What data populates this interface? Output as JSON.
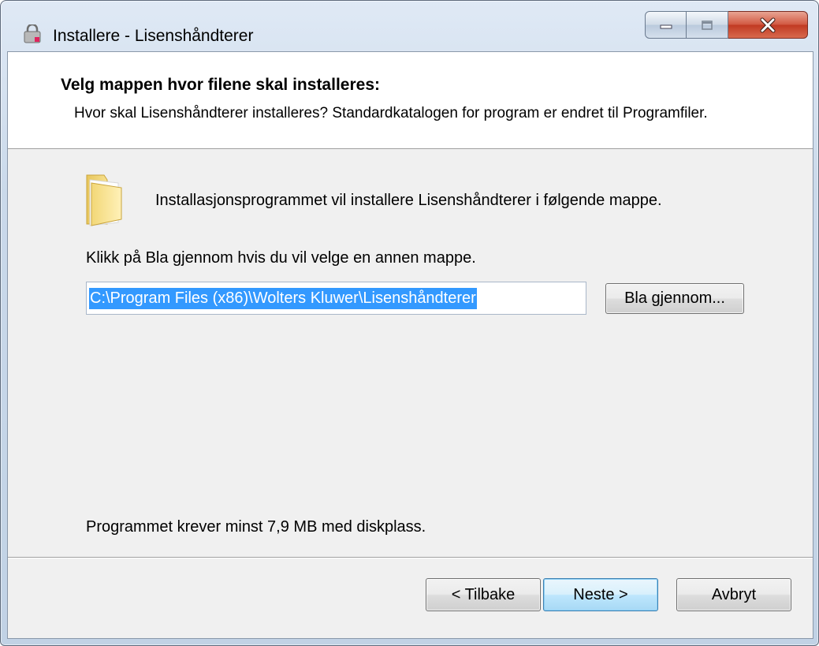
{
  "window": {
    "title": "Installere - Lisenshåndterer",
    "controls": {
      "minimize": "minimize",
      "maximize": "maximize",
      "close": "close"
    }
  },
  "header": {
    "title": "Velg mappen hvor filene skal installeres:",
    "subtitle": "Hvor skal Lisenshåndterer installeres? Standardkatalogen for program er endret til Programfiler."
  },
  "body": {
    "intro": "Installasjonsprogrammet vil installere Lisenshåndterer i følgende mappe.",
    "instruction": "Klikk på Bla gjennom hvis du vil velge en annen mappe.",
    "path_value": "C:\\Program Files (x86)\\Wolters Kluwer\\Lisenshåndterer",
    "browse_label": "Bla gjennom...",
    "disk_requirement": "Programmet krever minst 7,9 MB med diskplass."
  },
  "footer": {
    "back_label": "< Tilbake",
    "next_label": "Neste >",
    "cancel_label": "Avbryt"
  },
  "icons": {
    "app": "installer-lock-icon",
    "folder": "folder-icon"
  },
  "colors": {
    "selection": "#3399ff",
    "dialog_bg": "#f0f0f0",
    "close_button": "#c13a23"
  }
}
